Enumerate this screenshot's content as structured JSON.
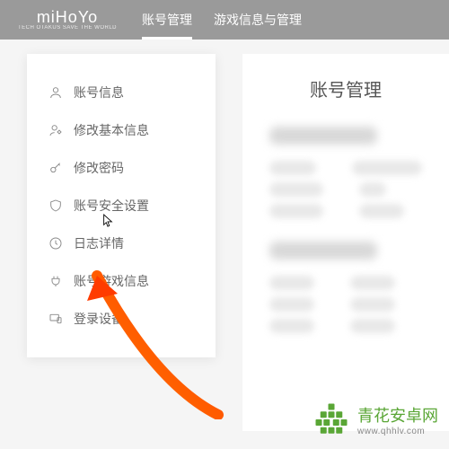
{
  "header": {
    "logo_main": "miHoYo",
    "logo_sub": "TECH OTAKUS SAVE THE WORLD",
    "tabs": [
      {
        "label": "账号管理",
        "active": true
      },
      {
        "label": "游戏信息与管理",
        "active": false
      }
    ]
  },
  "sidebar": {
    "items": [
      {
        "label": "账号信息",
        "icon": "user-icon"
      },
      {
        "label": "修改基本信息",
        "icon": "edit-user-icon"
      },
      {
        "label": "修改密码",
        "icon": "key-icon"
      },
      {
        "label": "账号安全设置",
        "icon": "shield-icon"
      },
      {
        "label": "日志详情",
        "icon": "clock-icon"
      },
      {
        "label": "账号游戏信息",
        "icon": "plug-icon"
      },
      {
        "label": "登录设备",
        "icon": "devices-icon"
      }
    ]
  },
  "main": {
    "title": "账号管理"
  },
  "watermark": {
    "brand": "青花安卓网",
    "url": "www.qhhlv.com"
  }
}
